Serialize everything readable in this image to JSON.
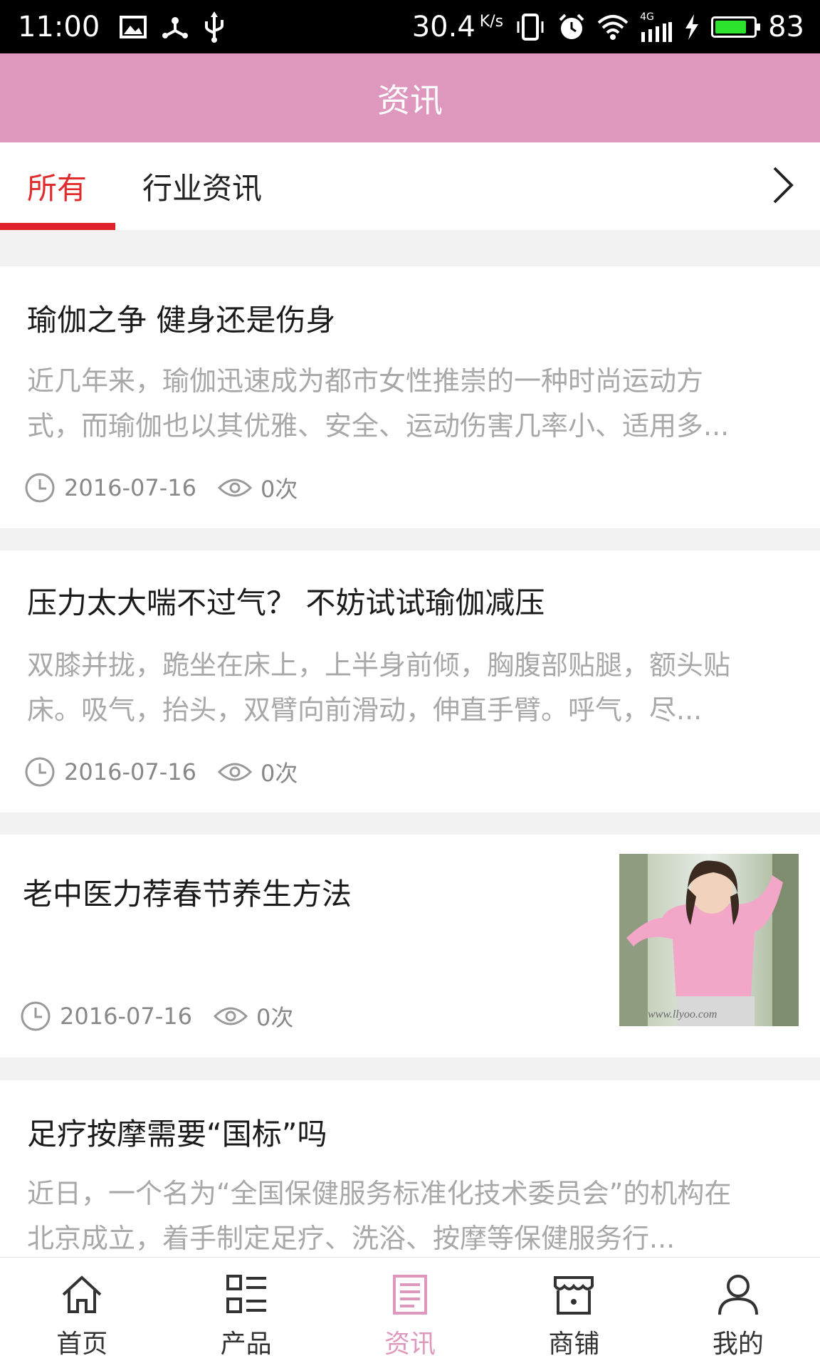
{
  "status_bar": {
    "time": "11:00",
    "net_speed": "30.4",
    "net_speed_unit": "K/s",
    "network_type": "4G",
    "battery_level": "83",
    "battery_fraction": 0.83,
    "battery_color": "#2ee32e"
  },
  "header": {
    "title": "资讯",
    "color": "#df98bd"
  },
  "tabs": [
    {
      "label": "所有",
      "active": true
    },
    {
      "label": "行业资讯",
      "active": false
    }
  ],
  "tab_accent": "#e0202a",
  "articles": [
    {
      "title": "瑜伽之争 健身还是伤身",
      "summary_line1": "近几年来，瑜伽迅速成为都市女性推崇的一种时尚运动方",
      "summary_line2": "式，而瑜伽也以其优雅、安全、运动伤害几率小、适用多...",
      "date": "2016-07-16",
      "views": "0次"
    },
    {
      "title": "压力太大喘不过气？ 不妨试试瑜伽减压",
      "summary_line1": "双膝并拢，跪坐在床上，上半身前倾，胸腹部贴腿，额头贴",
      "summary_line2": "床。吸气，抬头，双臂向前滑动，伸直手臂。呼气，尽...",
      "date": "2016-07-16",
      "views": "0次"
    },
    {
      "title": "老中医力荐春节养生方法",
      "date": "2016-07-16",
      "views": "0次",
      "thumbnail_watermark": "www.llyoo.com"
    },
    {
      "title": "足疗按摩需要“国标”吗",
      "summary_line1": "近日，一个名为“全国保健服务标准化技术委员会”的机构在",
      "summary_line2": "北京成立，着手制定足疗、洗浴、按摩等保健服务行..."
    }
  ],
  "bottom_nav": [
    {
      "label": "首页",
      "icon": "home-icon",
      "active": false
    },
    {
      "label": "产品",
      "icon": "product-grid-icon",
      "active": false
    },
    {
      "label": "资讯",
      "icon": "news-icon",
      "active": true
    },
    {
      "label": "商铺",
      "icon": "store-icon",
      "active": false
    },
    {
      "label": "我的",
      "icon": "user-icon",
      "active": false
    }
  ]
}
